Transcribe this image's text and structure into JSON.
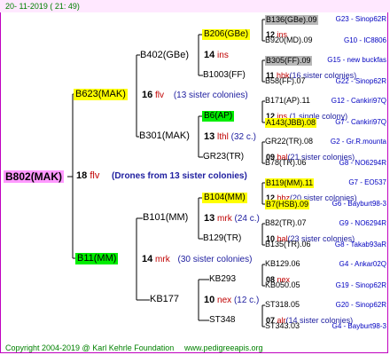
{
  "header": {
    "date": "20- 11-2019 ( 21: 49)"
  },
  "root": {
    "name": "B802(MAK)",
    "fv": "18",
    "fv_code": "flv",
    "drones": "(Drones from 13 sister colonies)",
    "bg": "#ff99ff"
  },
  "n_b623": {
    "name": "B623(MAK)",
    "bg": "#ffff00",
    "num": "16",
    "code": "flv",
    "sis": "(13 sister colonies)"
  },
  "n_b11": {
    "name": "B11(MM)",
    "bg": "#00ee00",
    "num": "14",
    "code": "mrk",
    "sis": "(30 sister colonies)"
  },
  "n_b402": {
    "name": "B402(GBe)",
    "num": "14",
    "code": "ins"
  },
  "n_b301": {
    "name": "B301(MAK)",
    "num": "13",
    "code": "lthl",
    "sis": "(32 c.)"
  },
  "n_b101": {
    "name": "B101(MM)",
    "num": "13",
    "code": "mrk",
    "sis": "(24 c.)"
  },
  "n_kb177": {
    "name": "KB177",
    "num": "10",
    "code": "nex",
    "sis": "(12 c.)"
  },
  "n_b206": {
    "name": "B206(GBe)",
    "bg": "#ffff00",
    "num": "12",
    "code": "ins"
  },
  "n_b1003": {
    "name": "B1003(FF)",
    "num": "11",
    "code": "hbk",
    "sis": "(16 sister colonies)"
  },
  "n_b6": {
    "name": "B6(AP)",
    "bg": "#00ee00",
    "num": "12",
    "code": "ins",
    "sis": "(1 single colony)"
  },
  "n_gr23": {
    "name": "GR23(TR)",
    "num": "09",
    "code": "bal",
    "sis": "(21 sister colonies)"
  },
  "n_b104": {
    "name": "B104(MM)",
    "bg": "#ffff00",
    "num": "12",
    "code": "hbz",
    "sis": "(20 sister colonies)"
  },
  "n_b129": {
    "name": "B129(TR)",
    "num": "10",
    "code": "bal",
    "sis": "(23 sister colonies)"
  },
  "n_kb293": {
    "name": "KB293",
    "num": "08",
    "code": "nex"
  },
  "n_st348": {
    "name": "ST348",
    "num": "07",
    "code": "alr",
    "sis": "(14 sister colonies)"
  },
  "leaves": [
    {
      "name": "B136(GBe).09",
      "info": "G23 - Sinop62R",
      "bg": "#b8b8b8"
    },
    {
      "name": "B920(MD).09",
      "info": "G10 - IC8806"
    },
    {
      "name": "B305(FF).09",
      "info": "G15 - new buckfas",
      "bg": "#b8b8b8"
    },
    {
      "name": "B58(FF).07",
      "info": "G22 - Sinop62R"
    },
    {
      "name": "B171(AP).11",
      "info": "G12 - Cankiri97Q"
    },
    {
      "name": "A143(JBB).08",
      "info": "G7 - Cankiri97Q",
      "bg": "#ffff00"
    },
    {
      "name": "GR22(TR).08",
      "info": "G2 - Gr.R.mounta"
    },
    {
      "name": "B78(TR).06",
      "info": "G8 - NO6294R"
    },
    {
      "name": "B119(MM).11",
      "info": "G7 - EO537",
      "bg": "#ffff00"
    },
    {
      "name": "B7(HSB).09",
      "info": "G6 - Bayburt98-3",
      "bg": "#ffff00"
    },
    {
      "name": "B82(TR).07",
      "info": "G9 - NO6294R"
    },
    {
      "name": "B135(TR).06",
      "info": "G8 - Takab93aR"
    },
    {
      "name": "KB129.06",
      "info": "G4 - Ankar02Q"
    },
    {
      "name": "KB050.05",
      "info": "G19 - Sinop62R"
    },
    {
      "name": "ST318.05",
      "info": "G20 - Sinop62R"
    },
    {
      "name": "ST343.03",
      "info": "G4 - Bayburt98-3"
    }
  ],
  "footer": {
    "copyright": "Copyright 2004-2019 @ Karl Kehrle Foundation",
    "url": "www.pedigreeapis.org"
  },
  "colors": {
    "border": "#c000c0",
    "line": "#000000",
    "code": "#c00000",
    "sister": "#2020a0",
    "info": "#0000c0",
    "footer": "#008000"
  }
}
